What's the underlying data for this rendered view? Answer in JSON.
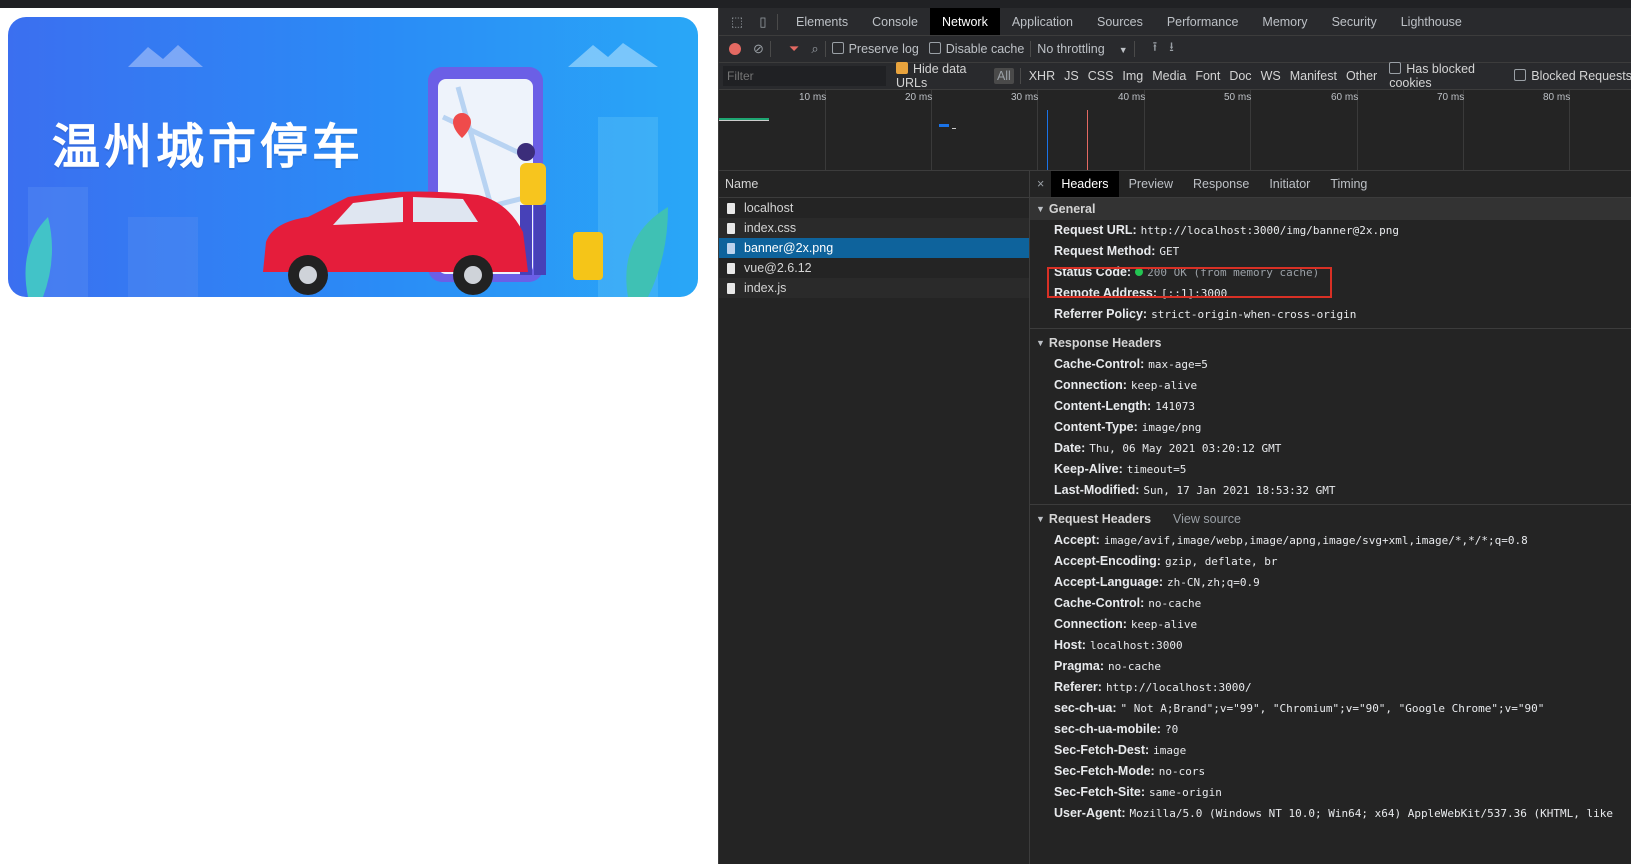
{
  "banner": {
    "title": "温州城市停车"
  },
  "devtools": {
    "tabs": [
      "Elements",
      "Console",
      "Network",
      "Application",
      "Sources",
      "Performance",
      "Memory",
      "Security",
      "Lighthouse"
    ],
    "active_tab": "Network",
    "toolbar": {
      "preserve_log": "Preserve log",
      "disable_cache": "Disable cache",
      "throttling": "No throttling"
    },
    "filterbar": {
      "placeholder": "Filter",
      "hide_data_urls": "Hide data URLs",
      "all": "All",
      "types": [
        "XHR",
        "JS",
        "CSS",
        "Img",
        "Media",
        "Font",
        "Doc",
        "WS",
        "Manifest",
        "Other"
      ],
      "has_blocked_cookies": "Has blocked cookies",
      "blocked_requests": "Blocked Requests"
    },
    "timeline": {
      "ticks": [
        "10 ms",
        "20 ms",
        "30 ms",
        "40 ms",
        "50 ms",
        "60 ms",
        "70 ms",
        "80 ms"
      ]
    },
    "requests": {
      "header": "Name",
      "items": [
        "localhost",
        "index.css",
        "banner@2x.png",
        "vue@2.6.12",
        "index.js"
      ],
      "selected": "banner@2x.png"
    },
    "detail_tabs": [
      "Headers",
      "Preview",
      "Response",
      "Initiator",
      "Timing"
    ],
    "general": {
      "title": "General",
      "rows": [
        {
          "k": "Request URL:",
          "v": "http://localhost:3000/img/banner@2x.png"
        },
        {
          "k": "Request Method:",
          "v": "GET"
        },
        {
          "k": "Status Code:",
          "v": "200 OK (from memory cache)"
        },
        {
          "k": "Remote Address:",
          "v": "[::1]:3000"
        },
        {
          "k": "Referrer Policy:",
          "v": "strict-origin-when-cross-origin"
        }
      ]
    },
    "response_headers": {
      "title": "Response Headers",
      "rows": [
        {
          "k": "Cache-Control:",
          "v": "max-age=5"
        },
        {
          "k": "Connection:",
          "v": "keep-alive"
        },
        {
          "k": "Content-Length:",
          "v": "141073"
        },
        {
          "k": "Content-Type:",
          "v": "image/png"
        },
        {
          "k": "Date:",
          "v": "Thu, 06 May 2021 03:20:12 GMT"
        },
        {
          "k": "Keep-Alive:",
          "v": "timeout=5"
        },
        {
          "k": "Last-Modified:",
          "v": "Sun, 17 Jan 2021 18:53:32 GMT"
        }
      ]
    },
    "request_headers": {
      "title": "Request Headers",
      "view_source": "View source",
      "rows": [
        {
          "k": "Accept:",
          "v": "image/avif,image/webp,image/apng,image/svg+xml,image/*,*/*;q=0.8"
        },
        {
          "k": "Accept-Encoding:",
          "v": "gzip, deflate, br"
        },
        {
          "k": "Accept-Language:",
          "v": "zh-CN,zh;q=0.9"
        },
        {
          "k": "Cache-Control:",
          "v": "no-cache"
        },
        {
          "k": "Connection:",
          "v": "keep-alive"
        },
        {
          "k": "Host:",
          "v": "localhost:3000"
        },
        {
          "k": "Pragma:",
          "v": "no-cache"
        },
        {
          "k": "Referer:",
          "v": "http://localhost:3000/"
        },
        {
          "k": "sec-ch-ua:",
          "v": "\" Not A;Brand\";v=\"99\", \"Chromium\";v=\"90\", \"Google Chrome\";v=\"90\""
        },
        {
          "k": "sec-ch-ua-mobile:",
          "v": "?0"
        },
        {
          "k": "Sec-Fetch-Dest:",
          "v": "image"
        },
        {
          "k": "Sec-Fetch-Mode:",
          "v": "no-cors"
        },
        {
          "k": "Sec-Fetch-Site:",
          "v": "same-origin"
        },
        {
          "k": "User-Agent:",
          "v": "Mozilla/5.0 (Windows NT 10.0; Win64; x64) AppleWebKit/537.36 (KHTML, like"
        }
      ]
    }
  }
}
